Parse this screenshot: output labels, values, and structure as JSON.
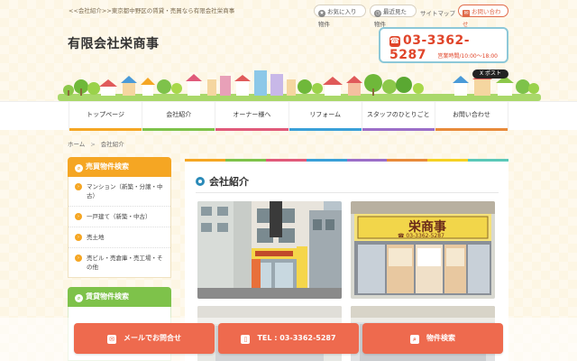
{
  "topbar": {
    "tagline": "<<会社紹介>>東京都中野区の賃貸・売買なら有限会社栄商事",
    "favorites_label": "お気に入り物件",
    "recent_label": "最近見た物件",
    "sitemap_label": "サイトマップ",
    "contact_label": "お問い合わせ"
  },
  "header": {
    "company_name": "有限会社栄商事",
    "phone": "03-3362-5287",
    "hours": "営業時間/10:00～18:00",
    "post_label": "X ポスト"
  },
  "nav": {
    "items": [
      {
        "label": "トップページ",
        "color": "#f5a623"
      },
      {
        "label": "会社紹介",
        "color": "#7ec24a"
      },
      {
        "label": "オーナー様へ",
        "color": "#e05a7a"
      },
      {
        "label": "リフォーム",
        "color": "#3aa0d8"
      },
      {
        "label": "スタッフのひとりごと",
        "color": "#9b6ec8"
      },
      {
        "label": "お問い合わせ",
        "color": "#e88a3a"
      }
    ]
  },
  "breadcrumb": {
    "home": "ホーム",
    "separator": ">",
    "current": "会社紹介"
  },
  "sidebar": {
    "sale_heading": "売買物件検索",
    "sale_items": [
      {
        "label": "マンション（新築・分譲・中古）"
      },
      {
        "label": "一戸建て（新築・中古）"
      },
      {
        "label": "売土地"
      },
      {
        "label": "売ビル・売倉庫・売工場・その他"
      }
    ],
    "rent_heading": "賃貸物件検索"
  },
  "main": {
    "title": "会社紹介",
    "stripe_colors": [
      "#f5a623",
      "#7ec24a",
      "#e05a7a",
      "#3aa0d8",
      "#9b6ec8",
      "#e88a3a",
      "#f5d123",
      "#5ac8b8"
    ],
    "photo2_sign_name": "栄商事",
    "photo2_sign_phone": "☎ 03-3362-5287"
  },
  "cta": {
    "mail_label": "メールでお問合せ",
    "tel_label": "TEL : 03-3362-5287",
    "search_label": "物件検索"
  },
  "icons": {
    "star": "★",
    "clock": "◷",
    "mail": "✉",
    "phone": "☎",
    "search": "⌕"
  }
}
